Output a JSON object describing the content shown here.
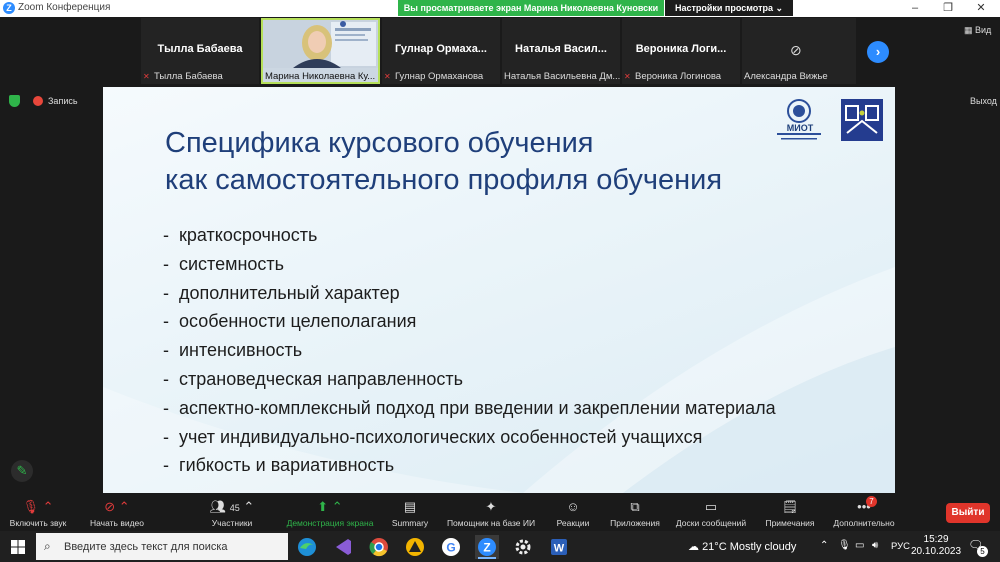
{
  "window": {
    "title": "Zoom Конференция",
    "logo_letter": "Z"
  },
  "share_banner": "Вы просматриваете экран Марина Николаевна Куновски",
  "view_settings_label": "Настройки просмотра",
  "view_button": "Вид",
  "exit_fullscreen_label": "Выход",
  "recording_label": "Запись",
  "participants_tiles": [
    {
      "name": "Тылла Бабаева",
      "caption": "Тылла Бабаева",
      "muted": true
    },
    {
      "name": "",
      "caption": "Марина Николаевна Ку...",
      "muted": false
    },
    {
      "name": "Гулнар Ормаха...",
      "caption": "Гулнар Ормаханова",
      "muted": true
    },
    {
      "name": "Наталья Васил...",
      "caption": "Наталья Васильевна Дм...",
      "muted": false
    },
    {
      "name": "Вероника Логи...",
      "caption": "Вероника Логинова",
      "muted": true
    },
    {
      "name": "",
      "caption": "Александра Вижье",
      "muted": false
    }
  ],
  "slide": {
    "title_line1": "Специфика курсового обучения",
    "title_line2": "как самостоятельного профиля обучения",
    "logo_text": "МИОТ",
    "bullets": [
      "краткосрочность",
      "системность",
      "дополнительный характер",
      "особенности целеполагания",
      "интенсивность",
      "страноведческая направленность",
      "аспектно-комплексный подход при введении и закреплении материала",
      "учет индивидуально-психологических особенностей учащихся",
      "гибкость и вариативность"
    ]
  },
  "toolbar": {
    "audio": "Включить звук",
    "video": "Начать видео",
    "participants": "Участники",
    "participants_count": "45",
    "share": "Демонстрация экрана",
    "summary": "Summary",
    "ai": "Помощник на базе ИИ",
    "reactions": "Реакции",
    "apps": "Приложения",
    "boards": "Доски сообщений",
    "notes": "Примечания",
    "more": "Дополнительно",
    "more_badge": "7",
    "exit": "Выйти"
  },
  "taskbar": {
    "search_placeholder": "Введите здесь текст для поиска",
    "weather": "21°C  Mostly cloudy",
    "lang": "РУС",
    "time": "15:29",
    "date": "20.10.2023",
    "notif_count": "5"
  },
  "colors": {
    "accent": "#2d8cff",
    "share_green": "#2fb44a",
    "exit_red": "#e0352b",
    "slide_title": "#1f3f7a"
  }
}
